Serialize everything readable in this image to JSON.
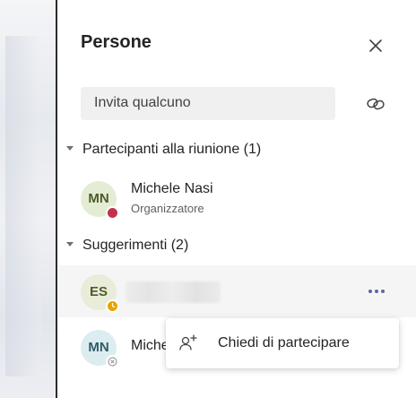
{
  "panel": {
    "title": "Persone",
    "invite_placeholder": "Invita qualcuno"
  },
  "sections": [
    {
      "label": "Partecipanti alla riunione (1)",
      "people": [
        {
          "initials": "MN",
          "name": "Michele Nasi",
          "role": "Organizzatore",
          "status": "busy",
          "status_color": "#c4314b"
        }
      ]
    },
    {
      "label": "Suggerimenti (2)",
      "people": [
        {
          "initials": "ES",
          "name": "",
          "status": "away",
          "status_color": "#eaa300"
        },
        {
          "initials": "MN",
          "name": "Miche",
          "status": "offline"
        }
      ]
    }
  ],
  "context_menu": {
    "item_label": "Chiedi di partecipare",
    "item_icon": "add-person-icon"
  },
  "colors": {
    "accent": "#6264a7",
    "busy": "#c4314b",
    "away": "#eaa300"
  }
}
